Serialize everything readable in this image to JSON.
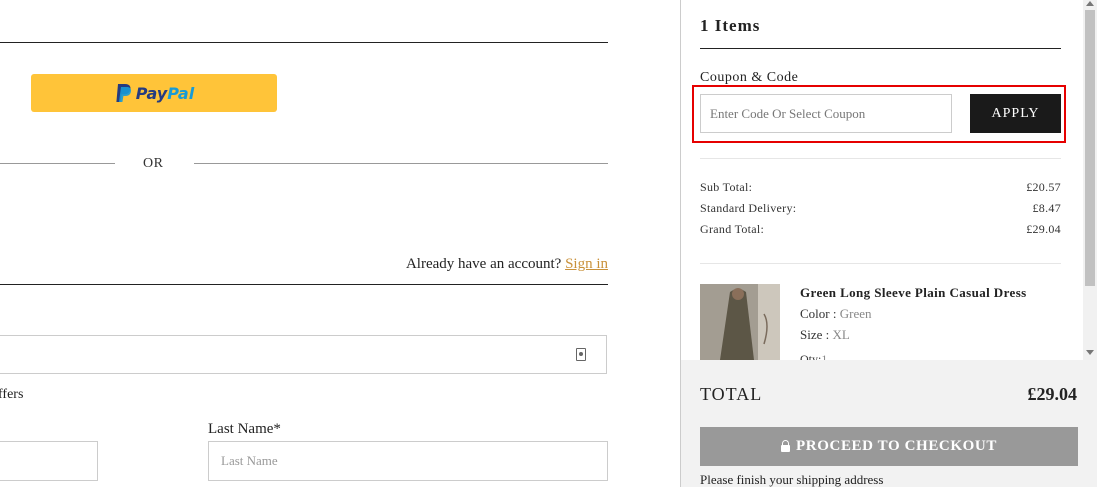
{
  "left": {
    "paypal": {
      "pay": "Pay",
      "pal": "Pal"
    },
    "or_text": "OR",
    "account_prompt": "Already have an account?",
    "sign_in": "Sign in",
    "offers_text": "ffers",
    "last_name_label": "Last Name*",
    "last_name_placeholder": "Last Name"
  },
  "cart": {
    "items_title": "1 Items",
    "coupon_label": "Coupon & Code",
    "coupon_placeholder": "Enter Code Or Select Coupon",
    "apply_label": "APPLY",
    "summary": [
      {
        "label": "Sub Total:",
        "value": "£20.57"
      },
      {
        "label": "Standard Delivery:",
        "value": "£8.47"
      },
      {
        "label": "Grand Total:",
        "value": "£29.04"
      }
    ],
    "product": {
      "name": "Green Long Sleeve Plain Casual Dress",
      "color_label": "Color :",
      "color_value": "Green",
      "size_label": "Size :",
      "size_value": "XL",
      "qty_label": "Qty:",
      "qty_value": "1"
    },
    "total_label": "TOTAL",
    "total_value": "£29.04",
    "checkout_label": "PROCEED TO CHECKOUT",
    "finish_note": "Please finish your shipping address"
  }
}
